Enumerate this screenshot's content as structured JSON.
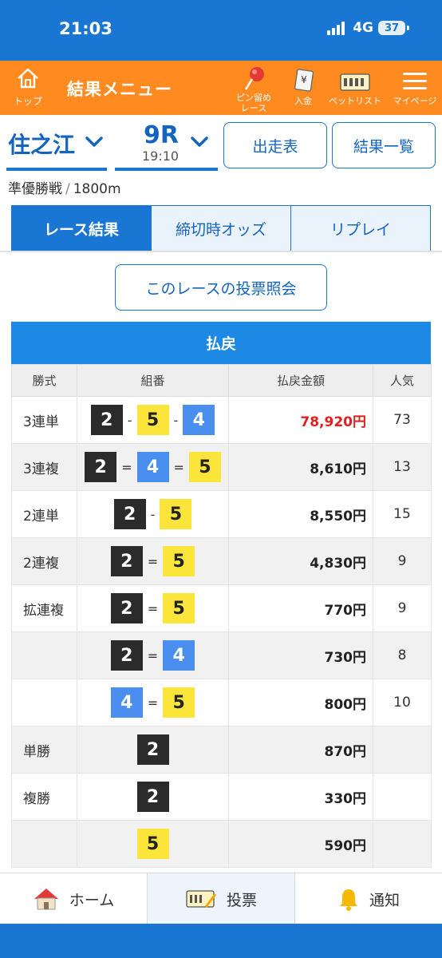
{
  "status": {
    "time": "21:03",
    "network": "4G",
    "battery": "37"
  },
  "nav": {
    "top_label": "トップ",
    "title": "結果メニュー",
    "pin_line1": "ピン留め",
    "pin_line2": "レース",
    "deposit": "入金",
    "betlist": "ベットリスト",
    "mypage": "マイページ"
  },
  "race": {
    "venue": "住之江",
    "race_no": "9R",
    "time": "19:10",
    "entries_button": "出走表",
    "results_button": "結果一覧",
    "race_name": "準優勝戦",
    "distance": "1800m"
  },
  "tabs": [
    "レース結果",
    "締切時オッズ",
    "リプレイ"
  ],
  "inquiry_button": "このレースの投票照会",
  "payout": {
    "title": "払戻",
    "headers": [
      "勝式",
      "組番",
      "払戻金額",
      "人気"
    ],
    "rows": [
      {
        "kind": "3連単",
        "combo": [
          "2",
          "5",
          "4"
        ],
        "sep": "-",
        "amount": "78,920円",
        "pop": "73"
      },
      {
        "kind": "3連複",
        "combo": [
          "2",
          "4",
          "5"
        ],
        "sep": "=",
        "amount": "8,610円",
        "pop": "13"
      },
      {
        "kind": "2連単",
        "combo": [
          "2",
          "5"
        ],
        "sep": "-",
        "amount": "8,550円",
        "pop": "15"
      },
      {
        "kind": "2連複",
        "combo": [
          "2",
          "5"
        ],
        "sep": "=",
        "amount": "4,830円",
        "pop": "9"
      },
      {
        "kind": "拡連複",
        "combo": [
          "2",
          "5"
        ],
        "sep": "=",
        "amount": "770円",
        "pop": "9"
      },
      {
        "kind": "",
        "combo": [
          "2",
          "4"
        ],
        "sep": "=",
        "amount": "730円",
        "pop": "8"
      },
      {
        "kind": "",
        "combo": [
          "4",
          "5"
        ],
        "sep": "=",
        "amount": "800円",
        "pop": "10"
      },
      {
        "kind": "単勝",
        "combo": [
          "2"
        ],
        "sep": "",
        "amount": "870円",
        "pop": ""
      },
      {
        "kind": "複勝",
        "combo": [
          "2"
        ],
        "sep": "",
        "amount": "330円",
        "pop": ""
      },
      {
        "kind": "",
        "combo": [
          "5"
        ],
        "sep": "",
        "amount": "590円",
        "pop": ""
      }
    ]
  },
  "bottom_nav": {
    "home": "ホーム",
    "vote": "投票",
    "notify": "通知"
  },
  "colors": {
    "header_blue": "#1976d2",
    "nav_orange": "#ff8a1f",
    "highlight_red": "#e0201d",
    "boat_2": "#2b2b2b",
    "boat_4": "#4a8ff0",
    "boat_5": "#fbe53a"
  }
}
